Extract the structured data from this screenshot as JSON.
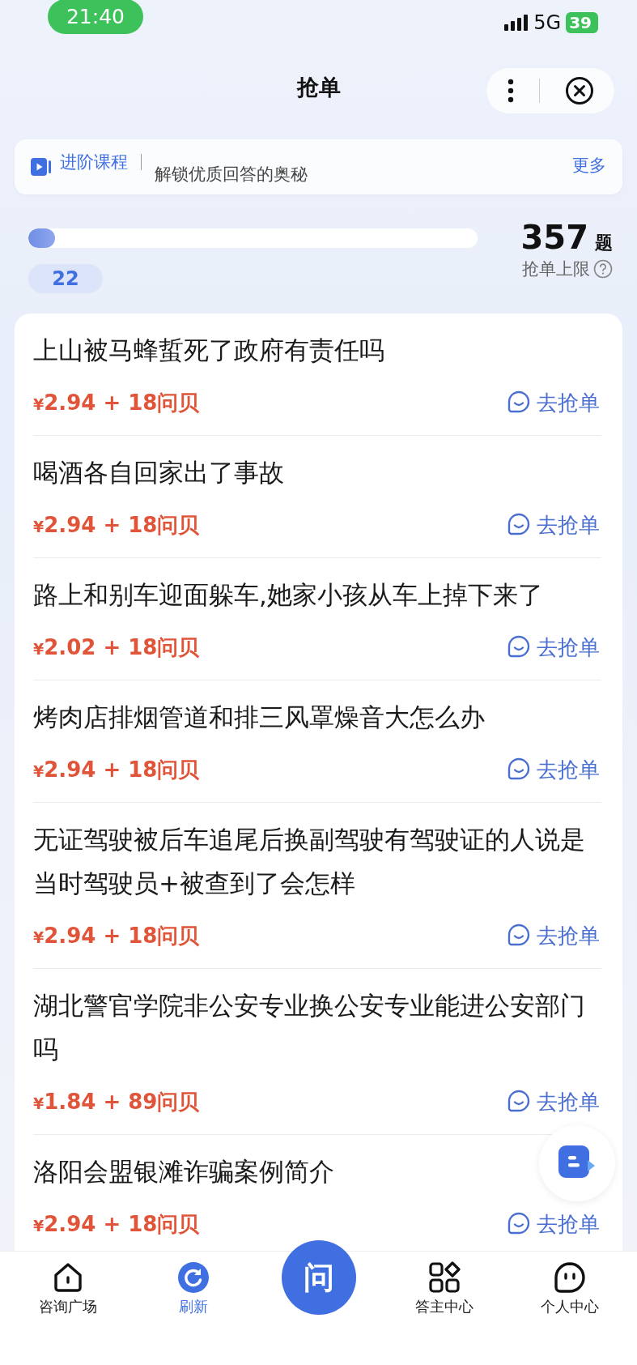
{
  "status_bar": {
    "time": "21:40",
    "network": "5G",
    "battery": "39"
  },
  "header": {
    "title": "抢单"
  },
  "banner": {
    "label": "进阶课程",
    "text": "解锁优质回答的奥秘",
    "more": "更多"
  },
  "progress": {
    "level": 0.06,
    "count": "22",
    "total": "357",
    "unit": "题",
    "limit_label": "抢单上限"
  },
  "questions": [
    {
      "title": "上山被马蜂蜇死了政府有责任吗",
      "currency": "¥",
      "amount": "2.94 + 18问贝",
      "action": "去抢单"
    },
    {
      "title": "喝酒各自回家出了事故",
      "currency": "¥",
      "amount": "2.94 + 18问贝",
      "action": "去抢单"
    },
    {
      "title": "路上和别车迎面躲车,她家小孩从车上掉下来了",
      "currency": "¥",
      "amount": "2.02 + 18问贝",
      "action": "去抢单"
    },
    {
      "title": "烤肉店排烟管道和排三风罩燥音大怎么办",
      "currency": "¥",
      "amount": "2.94 + 18问贝",
      "action": "去抢单"
    },
    {
      "title": "无证驾驶被后车追尾后换副驾驶有驾驶证的人说是当时驾驶员+被查到了会怎样",
      "currency": "¥",
      "amount": "2.94 + 18问贝",
      "action": "去抢单"
    },
    {
      "title": "湖北警官学院非公安专业换公安专业能进公安部门吗",
      "currency": "¥",
      "amount": "1.84 + 89问贝",
      "action": "去抢单"
    },
    {
      "title": "洛阳会盟银滩诈骗案例简介",
      "currency": "¥",
      "amount": "2.94 + 18问贝",
      "action": "去抢单"
    }
  ],
  "nav": [
    {
      "kind": "home",
      "label": "咨询广场",
      "selected": false
    },
    {
      "kind": "refresh",
      "label": "刷新",
      "selected": true
    },
    {
      "kind": "ask",
      "label": "问",
      "selected": false
    },
    {
      "kind": "grid",
      "label": "答主中心",
      "selected": false
    },
    {
      "kind": "face",
      "label": "个人中心",
      "selected": false
    }
  ]
}
